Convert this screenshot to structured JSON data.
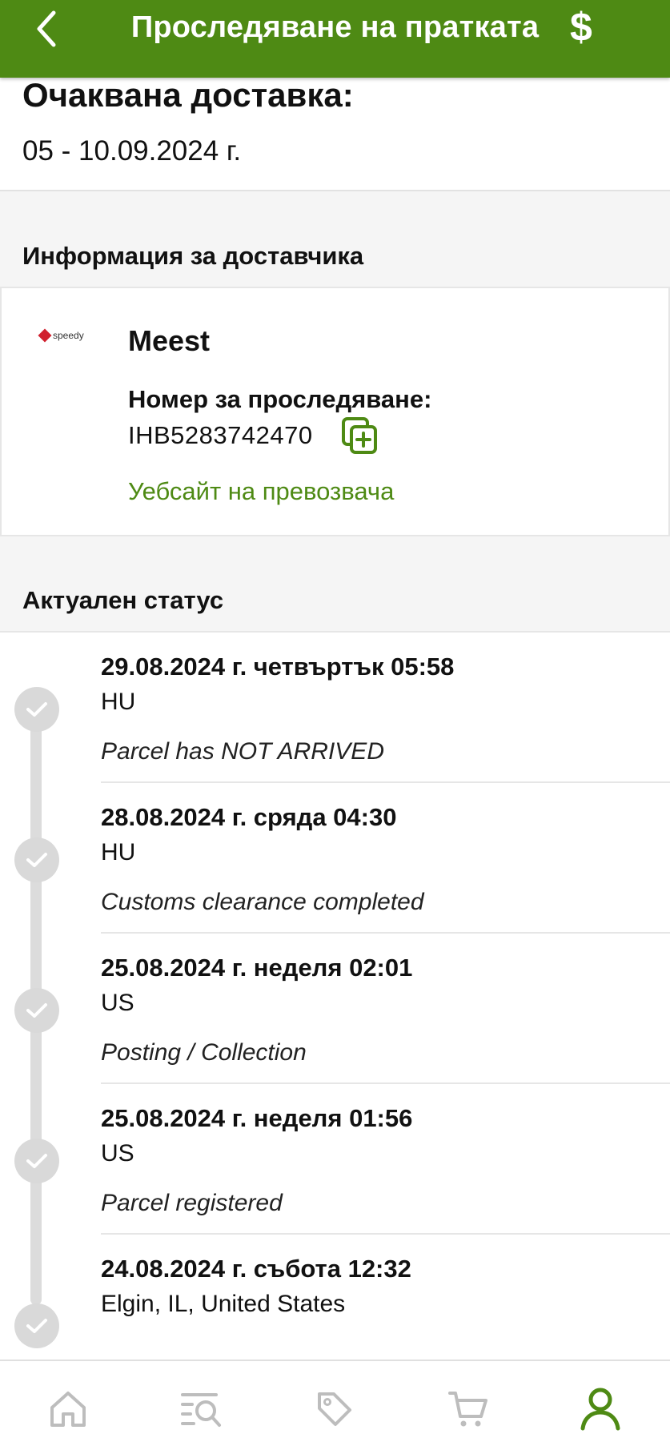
{
  "header": {
    "title": "Проследяване на пратката",
    "back_icon": "chevron-left-icon",
    "right_icon_glyph": "$",
    "color": "#4e8a14"
  },
  "delivery": {
    "label": "Очаквана доставка:",
    "value": "05 - 10.09.2024 г."
  },
  "carrier_section": {
    "title": "Информация за доставчика",
    "logo_text": "speedy",
    "name": "Meest",
    "tracking_label": "Номер за проследяване:",
    "tracking_number": "IHB5283742470",
    "website_link": "Уебсайт на превозвача"
  },
  "status_section": {
    "title": "Актуален статус",
    "events": [
      {
        "date": "29.08.2024 г. четвъртък 05:58",
        "location": "HU",
        "description": "Parcel has NOT ARRIVED"
      },
      {
        "date": "28.08.2024 г. сряда 04:30",
        "location": "HU",
        "description": "Customs clearance completed"
      },
      {
        "date": "25.08.2024 г. неделя 02:01",
        "location": "US",
        "description": "Posting / Collection"
      },
      {
        "date": "25.08.2024 г. неделя 01:56",
        "location": "US",
        "description": "Parcel registered"
      },
      {
        "date": "24.08.2024 г. събота 12:32",
        "location": "Elgin, IL, United States",
        "description": ""
      }
    ]
  },
  "bottom_nav": {
    "items": [
      "home-icon",
      "search-list-icon",
      "tag-icon",
      "cart-icon",
      "profile-icon"
    ],
    "active": "profile-icon",
    "active_color": "#4e8a14",
    "inactive_color": "#bdbdbd"
  }
}
